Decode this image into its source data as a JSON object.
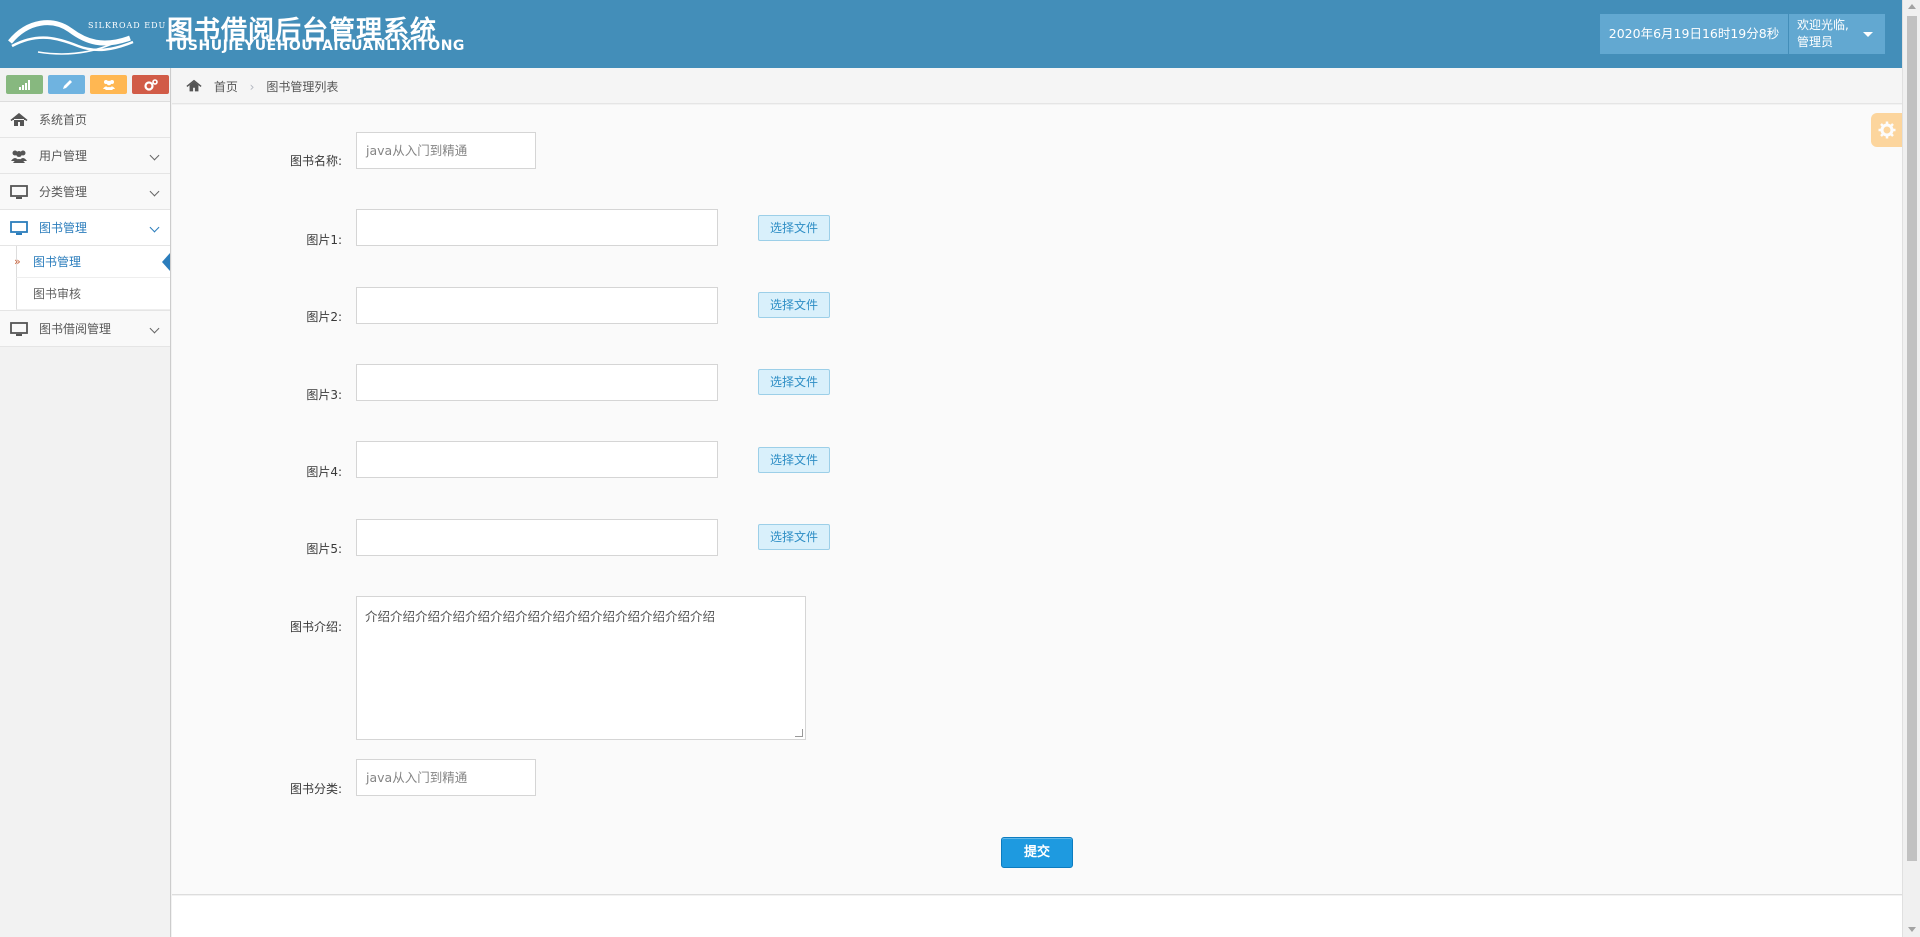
{
  "header": {
    "logo_text": "SILKROAD EDU",
    "title": "图书借阅后台管理系统",
    "subtitle": "TUSHUJIEYUEHOUTAIGUANLIXITONG",
    "datetime": "2020年6月19日16时19分8秒",
    "welcome": "欢迎光临,",
    "role": "管理员"
  },
  "shortcuts": [
    {
      "icon": "signal-icon",
      "color": "#87b87f"
    },
    {
      "icon": "pencil-icon",
      "color": "#6fb3e0"
    },
    {
      "icon": "users-icon",
      "color": "#ffb752"
    },
    {
      "icon": "cogs-icon",
      "color": "#d15b47"
    }
  ],
  "sidebar": {
    "items": [
      {
        "label": "系统首页",
        "icon": "home-icon"
      },
      {
        "label": "用户管理",
        "icon": "users-icon"
      },
      {
        "label": "分类管理",
        "icon": "desktop-icon"
      },
      {
        "label": "图书管理",
        "icon": "desktop-icon",
        "active": true
      },
      {
        "label": "图书借阅管理",
        "icon": "desktop-icon"
      }
    ],
    "submenu": [
      {
        "label": "图书管理",
        "active": true
      },
      {
        "label": "图书审核"
      }
    ]
  },
  "breadcrumb": {
    "home": "首页",
    "current": "图书管理列表"
  },
  "form": {
    "name_label": "图书名称:",
    "name_value": "java从入门到精通",
    "images": [
      {
        "label": "图片1:",
        "button": "选择文件"
      },
      {
        "label": "图片2:",
        "button": "选择文件"
      },
      {
        "label": "图片3:",
        "button": "选择文件"
      },
      {
        "label": "图片4:",
        "button": "选择文件"
      },
      {
        "label": "图片5:",
        "button": "选择文件"
      }
    ],
    "intro_label": "图书介绍:",
    "intro_value": "介绍介绍介绍介绍介绍介绍介绍介绍介绍介绍介绍介绍介绍介绍",
    "category_label": "图书分类:",
    "category_value": "java从入门到精通",
    "submit": "提交"
  },
  "colors": {
    "header": "#438eb9",
    "header_box": "#62a8d1",
    "primary": "#2b7dbc",
    "submit": "#1e9ae0"
  }
}
